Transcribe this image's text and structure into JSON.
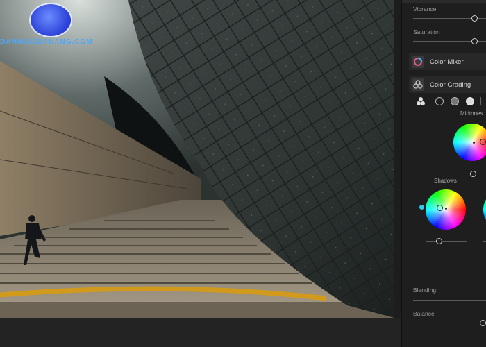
{
  "watermark": {
    "text": "DANHGIADANANG.COM"
  },
  "panel": {
    "vibrance": {
      "label": "Vibrance",
      "value_fraction": 0.72
    },
    "saturation": {
      "label": "Saturation",
      "value_fraction": 0.72
    },
    "color_mixer": {
      "title": "Color Mixer",
      "icon": "color-mixer-icon"
    },
    "color_grading": {
      "title": "Color Grading",
      "icon": "color-grading-icon",
      "modes": [
        "three-way",
        "shadows",
        "midtones",
        "highlights",
        "global"
      ],
      "midtones": {
        "label": "Midtones",
        "luminance_fraction": 0.5
      },
      "shadows": {
        "label": "Shadows",
        "luminance_fraction": 0.5
      },
      "blending": {
        "label": "Blending",
        "value_fraction": 1.0
      },
      "balance": {
        "label": "Balance",
        "value_fraction": 0.9
      }
    }
  },
  "colors": {
    "wheel_handle_accent": "#33c6e6",
    "logo_blue": "#4aa8ff"
  }
}
